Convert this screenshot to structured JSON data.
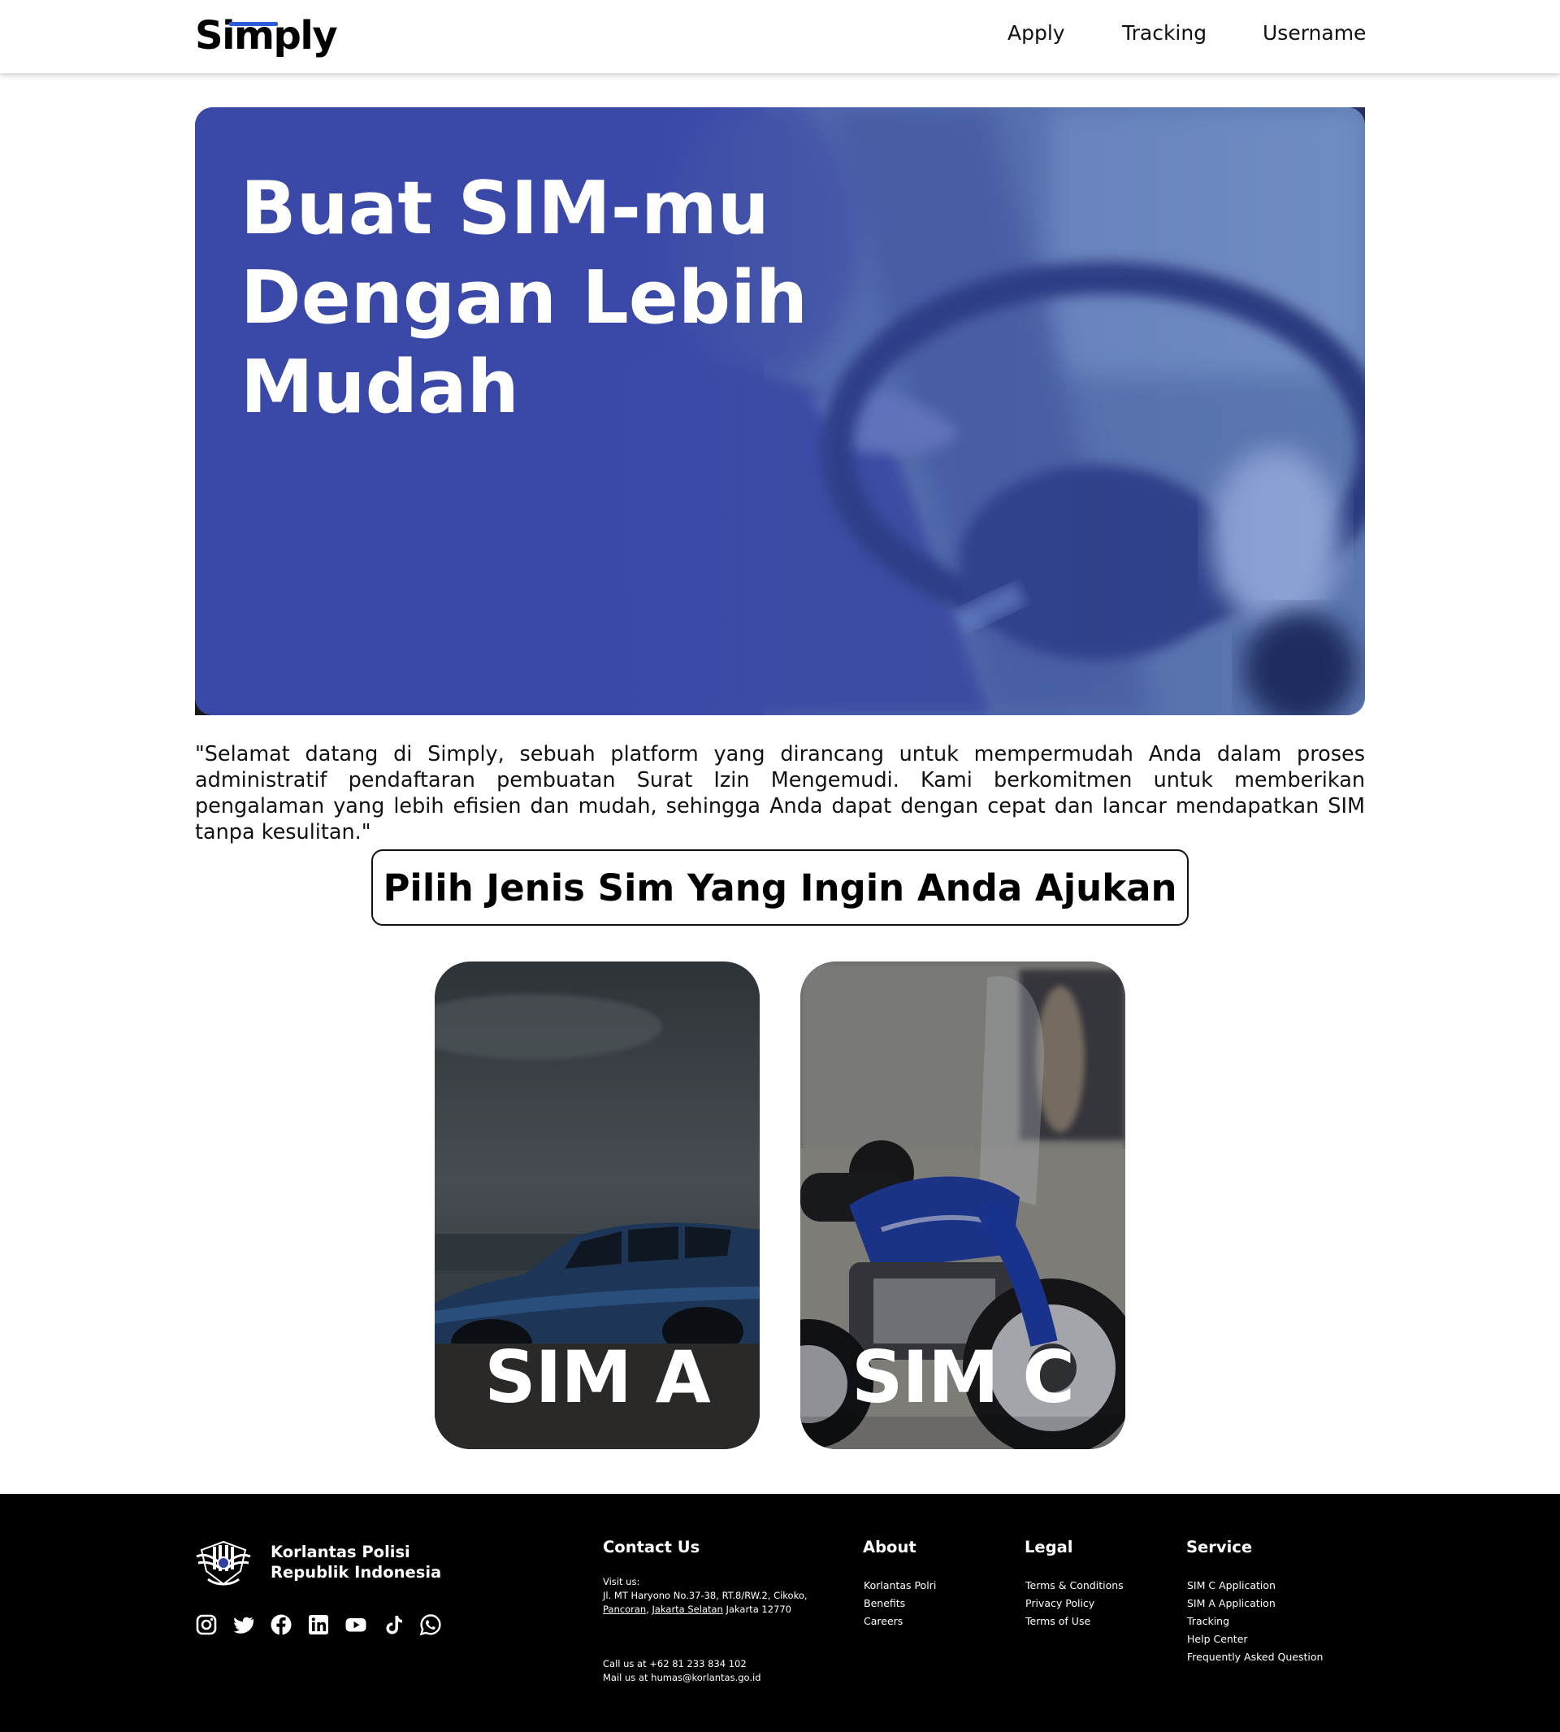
{
  "header": {
    "logo_text": "Simply",
    "nav": {
      "apply": "Apply",
      "tracking": "Tracking",
      "username": "Username"
    }
  },
  "hero": {
    "title_line1": "Buat SIM-mu",
    "title_line2": "Dengan Lebih",
    "title_line3": "Mudah"
  },
  "intro": {
    "text": "\"Selamat datang di Simply, sebuah platform yang dirancang untuk mempermudah Anda dalam proses administratif pendaftaran pembuatan Surat Izin Mengemudi. Kami berkomitmen untuk memberikan pengalaman yang lebih efisien dan mudah, sehingga Anda dapat dengan cepat dan lancar mendapatkan SIM tanpa kesulitan.\""
  },
  "choose": {
    "heading": "Pilih Jenis Sim Yang Ingin Anda Ajukan"
  },
  "cards": {
    "sim_a": "SIM A",
    "sim_c": "SIM C"
  },
  "footer": {
    "org_line1": "Korlantas Polisi",
    "org_line2": "Republik Indonesia",
    "socials": [
      "instagram-icon",
      "twitter-icon",
      "facebook-icon",
      "linkedin-icon",
      "youtube-icon",
      "tiktok-icon",
      "whatsapp-icon"
    ],
    "contact": {
      "title": "Contact Us",
      "visit_label": "Visit us:",
      "address_part1": "Jl. MT Haryono No.37-38, RT.8/RW.2, Cikoko,",
      "address_link1": "Pancoran",
      "address_sep": ",",
      "address_link2": "Jakarta Selatan",
      "address_part2": "Jakarta 12770",
      "phone": "Call us at +62 81 233 834 102",
      "mail": "Mail us at humas@korlantas.go.id"
    },
    "about": {
      "title": "About",
      "items": [
        "Korlantas Polri",
        "Benefits",
        "Careers"
      ]
    },
    "legal": {
      "title": "Legal",
      "items": [
        "Terms & Conditions",
        "Privacy Policy",
        "Terms of Use"
      ]
    },
    "service": {
      "title": "Service",
      "items": [
        "SIM C Application",
        "SIM A Application",
        "Tracking",
        "Help Center",
        "Frequently Asked Question"
      ]
    }
  }
}
